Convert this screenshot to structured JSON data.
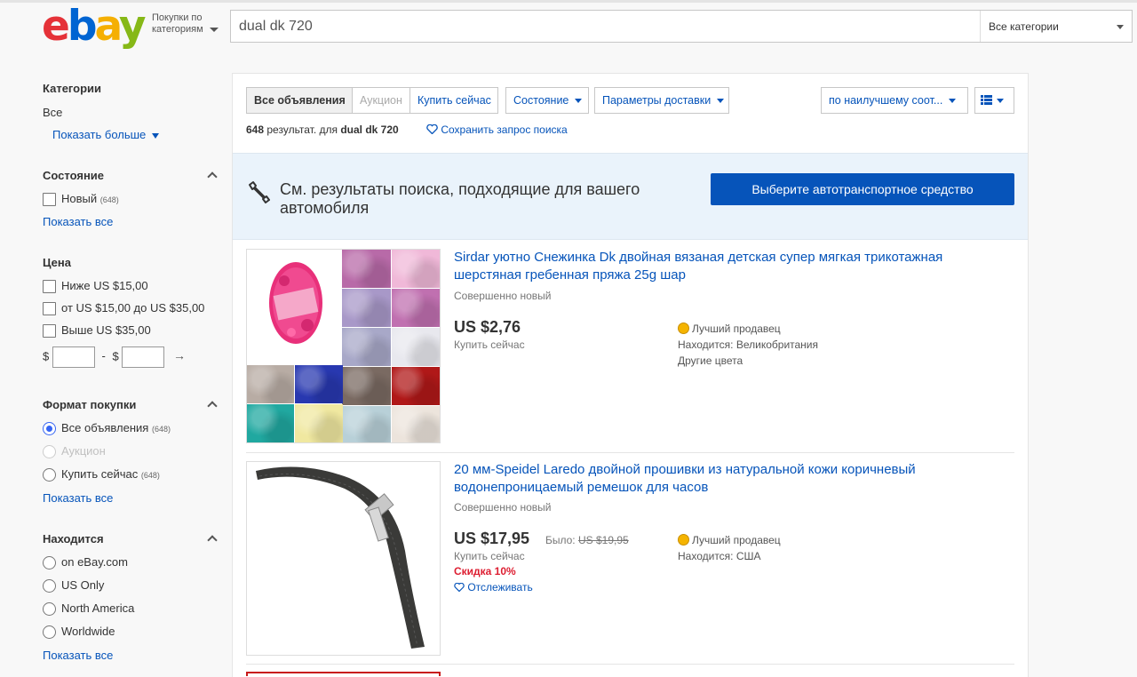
{
  "header": {
    "logo": {
      "e": "e",
      "b": "b",
      "a": "a",
      "y": "y"
    },
    "shop_by_line1": "Покупки по",
    "shop_by_line2": "категориям",
    "search_value": "dual dk 720",
    "category_select": "Все категории"
  },
  "sidebar": {
    "categories": {
      "title": "Категории",
      "all": "Все",
      "show_more": "Показать больше"
    },
    "condition": {
      "title": "Состояние",
      "options": [
        {
          "label": "Новый",
          "count": "(648)"
        }
      ],
      "show_all": "Показать все"
    },
    "price": {
      "title": "Цена",
      "options": [
        "Ниже US $15,00",
        "от US $15,00 до US $35,00",
        "Выше US $35,00"
      ],
      "currency": "$",
      "dash": "-"
    },
    "format": {
      "title": "Формат покупки",
      "options": [
        {
          "label": "Все объявления",
          "count": "(648)"
        },
        {
          "label": "Аукцион",
          "count": ""
        },
        {
          "label": "Купить сейчас",
          "count": "(648)"
        }
      ],
      "show_all": "Показать все"
    },
    "location": {
      "title": "Находится",
      "options": [
        "on eBay.com",
        "US Only",
        "North America",
        "Worldwide"
      ],
      "show_all": "Показать все"
    }
  },
  "toolbar": {
    "seg_all": "Все объявления",
    "seg_auction": "Аукцион",
    "seg_buynow": "Купить сейчас",
    "condition": "Состояние",
    "shipping": "Параметры доставки",
    "sort": "по наилучшему соот...",
    "result_count": "648",
    "result_text": "результат. для",
    "query": "dual dk 720",
    "save_search": "Сохранить запрос поиска"
  },
  "banner": {
    "text": "См. результаты поиска, подходящие для вашего автомобиля",
    "button": "Выберите автотранспортное средство"
  },
  "items": [
    {
      "title": "Sirdar уютно Снежинка Dk двойная вязаная детская супер мягкая трикотажная шерстяная гребенная пряжа 25g шар",
      "condition": "Совершенно новый",
      "price": "US $2,76",
      "buy_format": "Купить сейчас",
      "top_seller": "Лучший продавец",
      "location": "Находится: Великобритания",
      "extra": "Другие цвета",
      "swatches": [
        "#b86aa8",
        "#f0b8d8",
        "#a898c8",
        "#c070b0",
        "#a8a8c8",
        "#e8e8ee",
        "#7a6a62",
        "#b01818",
        "#b8d0d8",
        "#ece4dc",
        "#b8aca4",
        "#2838b0",
        "#20a8a0",
        "#f0e8a0"
      ]
    },
    {
      "title": "20 мм-Speidel Laredo двойной прошивки из натуральной кожи коричневый водонепроницаемый ремешок для часов",
      "condition": "Совершенно новый",
      "price": "US $17,95",
      "was_label": "Было:",
      "was_price": "US $19,95",
      "buy_format": "Купить сейчас",
      "discount": "Скидка 10%",
      "watch": "Отслеживать",
      "top_seller": "Лучший продавец",
      "location": "Находится: США"
    }
  ],
  "colors": {
    "link": "#0654ba",
    "button": "#0654ba",
    "discount": "#dd1e31",
    "banner_bg": "#eaf3fb"
  }
}
